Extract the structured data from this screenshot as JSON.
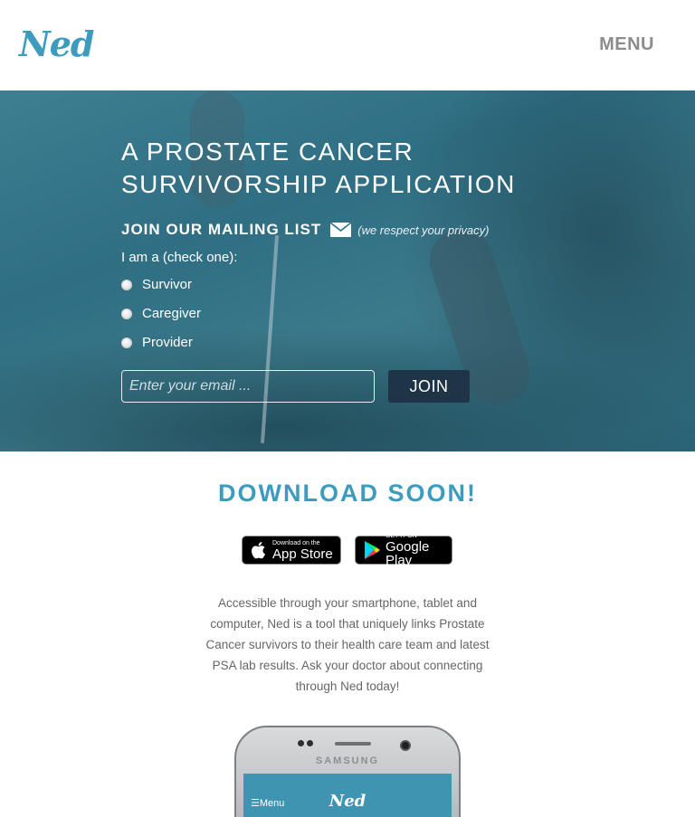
{
  "header": {
    "logo": "Ned",
    "menu_label": "MENU"
  },
  "hero": {
    "title": "A PROSTATE CANCER SURVIVORSHIP APPLICATION",
    "mailing_title": "JOIN OUR MAILING LIST",
    "privacy_note": "(we respect your privacy)",
    "check_label": "I am a (check one):",
    "options": [
      "Survivor",
      "Caregiver",
      "Provider"
    ],
    "email_placeholder": "Enter your email ...",
    "join_label": "JOIN"
  },
  "download": {
    "title": "DOWNLOAD SOON!",
    "app_store": {
      "small": "Download on the",
      "big": "App Store"
    },
    "google_play": {
      "small": "GET IT ON",
      "big": "Google Play"
    },
    "description": "Accessible through your smartphone, tablet and computer, Ned is a tool that uniquely links Prostate Cancer survivors to their health care team and latest PSA lab results. Ask your doctor about connecting through Ned today!"
  },
  "phone": {
    "brand": "SAMSUNG",
    "screen_menu": "☰Menu",
    "screen_logo": "Ned"
  },
  "colors": {
    "accent": "#3d9cbd",
    "join_button": "#1f3447",
    "menu_text": "#8c8c8c"
  },
  "icons": [
    "mail-icon",
    "apple-icon",
    "google-play-icon"
  ]
}
